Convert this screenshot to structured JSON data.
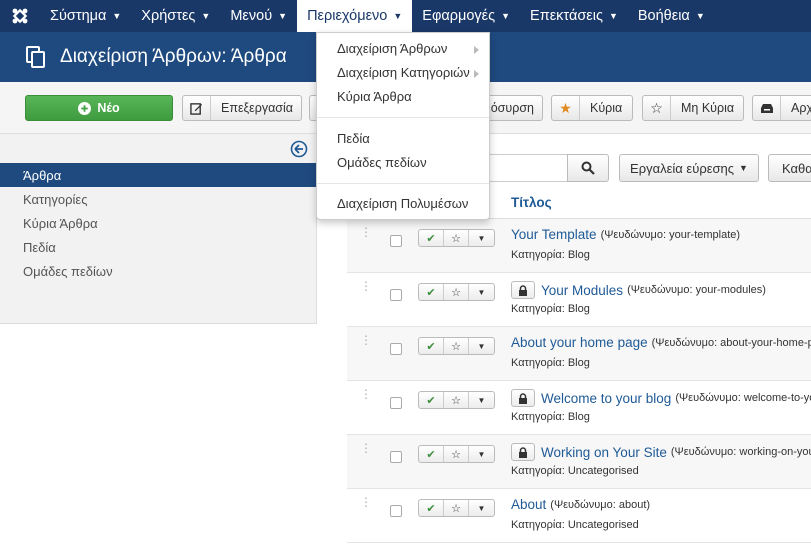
{
  "nav": {
    "items": [
      "Σύστημα",
      "Χρήστες",
      "Μενού",
      "Περιεχόμενο",
      "Εφαρμογές",
      "Επεκτάσεις",
      "Βοήθεια"
    ],
    "active_index": 3
  },
  "header": {
    "title": "Διαχείριση Άρθρων: Άρθρα"
  },
  "toolbar": {
    "new_label": "Νέο",
    "edit_label": "Επεξεργασία",
    "archive_partial_label": "όσυρση",
    "featured_label": "Κύρια",
    "unfeatured_label": "Μη Κύρια",
    "archive2_partial_label": "Αρχ"
  },
  "sidebar": {
    "items": [
      "Άρθρα",
      "Κατηγορίες",
      "Κύρια Άρθρα",
      "Πεδία",
      "Ομάδες πεδίων"
    ],
    "active_index": 0
  },
  "filters": {
    "tools_label": "Εργαλεία εύρεσης",
    "clear_partial_label": "Καθα"
  },
  "table": {
    "title_header": "Τίτλος",
    "rows": [
      {
        "title": "Your Template",
        "alias": "(Ψευδώνυμο: your-template)",
        "category": "Κατηγορία: Blog",
        "locked": false
      },
      {
        "title": "Your Modules",
        "alias": "(Ψευδώνυμο: your-modules)",
        "category": "Κατηγορία: Blog",
        "locked": true
      },
      {
        "title": "About your home page",
        "alias": "(Ψευδώνυμο: about-your-home-pa",
        "category": "Κατηγορία: Blog",
        "locked": false
      },
      {
        "title": "Welcome to your blog",
        "alias": "(Ψευδώνυμο: welcome-to-yo",
        "category": "Κατηγορία: Blog",
        "locked": true
      },
      {
        "title": "Working on Your Site",
        "alias": "(Ψευδώνυμο: working-on-you",
        "category": "Κατηγορία: Uncategorised",
        "locked": true
      },
      {
        "title": "About",
        "alias": "(Ψευδώνυμο: about)",
        "category": "Κατηγορία: Uncategorised",
        "locked": false
      }
    ]
  },
  "dropdown": {
    "items": [
      "Διαχείριση Άρθρων",
      "Διαχείριση Κατηγοριών",
      "Κύρια Άρθρα",
      "Πεδία",
      "Ομάδες πεδίων",
      "Διαχείριση Πολυμέσων"
    ]
  },
  "colors": {
    "navbar": "#1a3867",
    "header": "#1f4a7f",
    "new_button": "#46a546",
    "link": "#1f5a96",
    "published_check": "#3c8f3c",
    "featured_star": "#e08a1e"
  }
}
